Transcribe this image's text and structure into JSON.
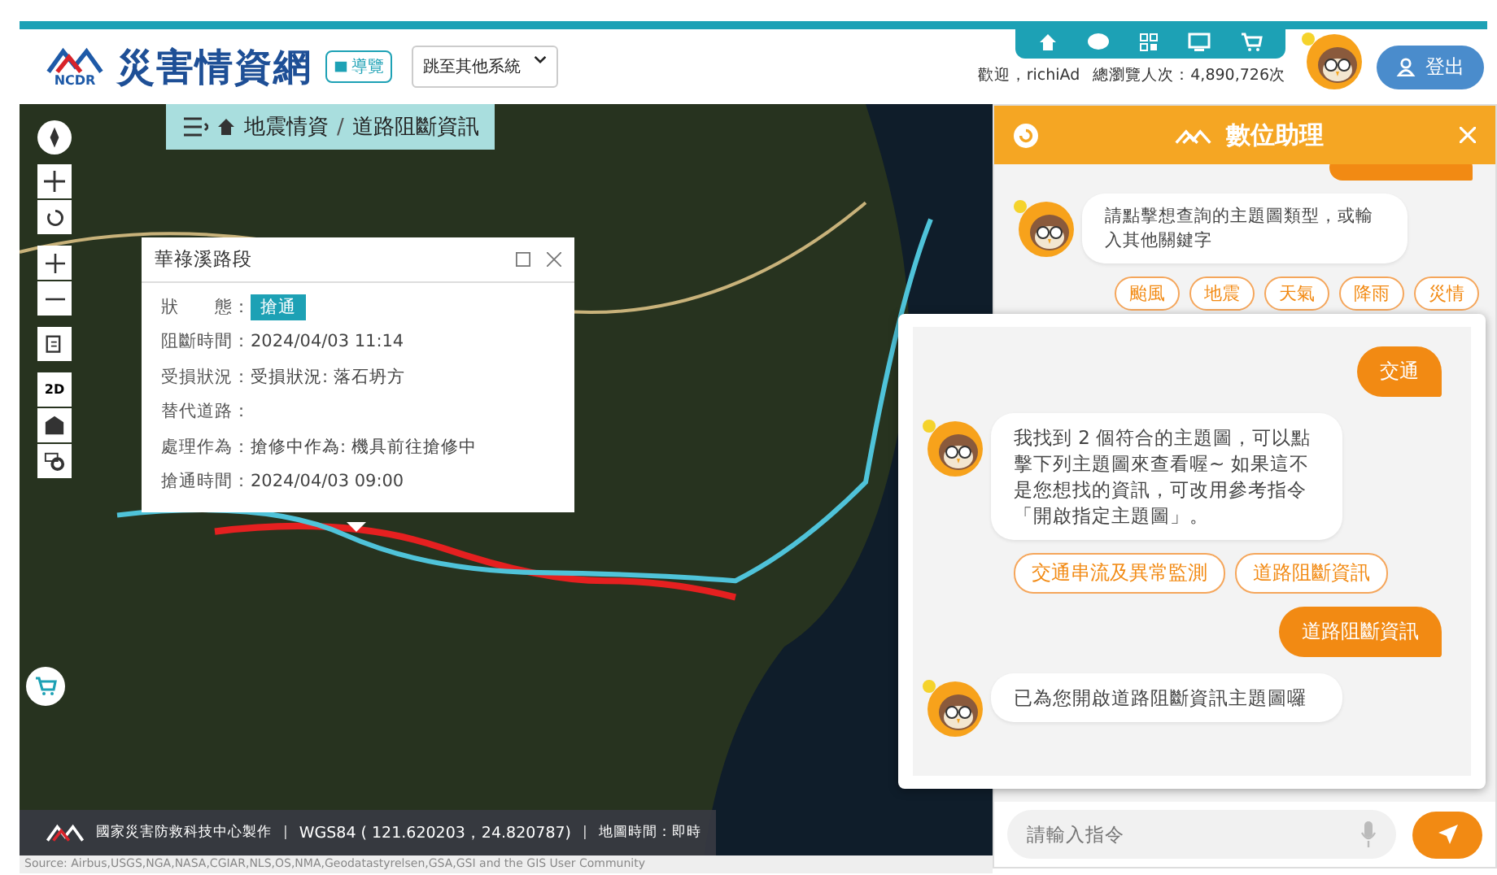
{
  "header": {
    "logo_caption": "NCDR",
    "title": "災害情資網",
    "guide_button": "導覽",
    "system_select": "跳至其他系統",
    "welcome": "歡迎，richiAd",
    "visits": "總瀏覽人次：4,890,726次",
    "logout_button": "登出"
  },
  "breadcrumb": {
    "items": [
      "地震情資",
      "道路阻斷資訊"
    ],
    "separator": "/"
  },
  "map_tools": {
    "view_toggle": "2D"
  },
  "popup": {
    "title": "華祿溪路段",
    "fields": [
      {
        "label": "狀　　態：",
        "value": "搶通",
        "kind": "badge"
      },
      {
        "label": "阻斷時間：",
        "value": "2024/04/03 11:14",
        "kind": "text"
      },
      {
        "label": "受損狀況：",
        "value": "受損狀況: 落石坍方",
        "kind": "text"
      },
      {
        "label": "替代道路：",
        "kind": "text"
      },
      {
        "label": "處理作為：",
        "value": "搶修中作為: 機具前往搶修中",
        "kind": "text"
      },
      {
        "label": "搶通時間：",
        "value": "2024/04/03 09:00",
        "kind": "text"
      }
    ]
  },
  "footer": {
    "organization": "國家災害防救科技中心製作",
    "coordinates": "WGS84 ( 121.620203，24.820787)",
    "map_time": "地圖時間：即時",
    "separator": "|"
  },
  "attribution": "Source: Airbus,USGS,NGA,NASA,CGIAR,NLS,OS,NMA,Geodatastyrelsen,GSA,GSI and the GIS User Community",
  "assistant": {
    "title": "數位助理",
    "messages": [
      {
        "kind": "user"
      },
      {
        "kind": "bot",
        "text": "請點擊想查詢的主題圖類型，或輸入其他關鍵字",
        "options": [
          "颱風",
          "地震",
          "天氣",
          "降雨",
          "災情"
        ]
      }
    ],
    "input_placeholder": "請輸入指令"
  },
  "expanded_chat": {
    "messages": [
      {
        "kind": "user",
        "text": "交通"
      },
      {
        "kind": "bot",
        "text": "我找到 2 個符合的主題圖，可以點擊下列主題圖來查看喔~ 如果這不是您想找的資訊，可改用參考指令「開啟指定主題圖」。",
        "options": [
          "交通串流及異常監測",
          "道路阻斷資訊"
        ]
      },
      {
        "kind": "user",
        "text": "道路阻斷資訊"
      },
      {
        "kind": "bot",
        "text": "已為您開啟道路阻斷資訊主題圖囉"
      }
    ]
  }
}
